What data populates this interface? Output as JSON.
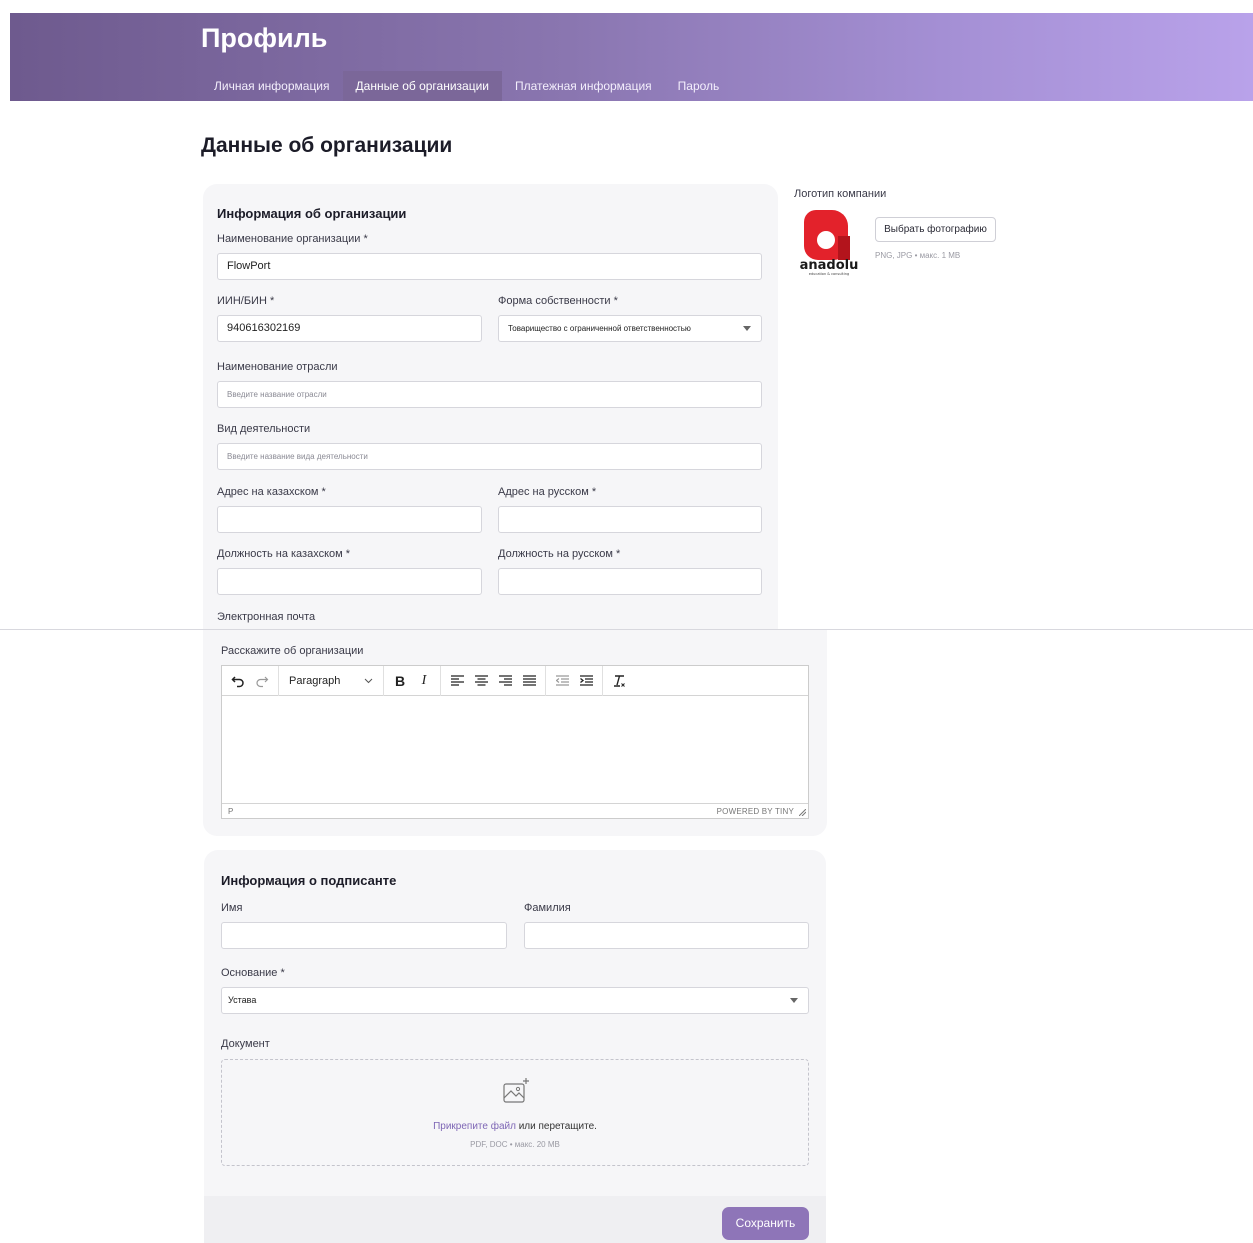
{
  "header": {
    "title": "Профиль",
    "tabs": [
      {
        "label": "Личная информация",
        "active": false
      },
      {
        "label": "Данные об организации",
        "active": true
      },
      {
        "label": "Платежная информация",
        "active": false
      },
      {
        "label": "Пароль",
        "active": false
      }
    ]
  },
  "page_title": "Данные об организации",
  "org_section": {
    "title": "Информация об организации",
    "org_name": {
      "label": "Наименование организации *",
      "value": "FlowPort"
    },
    "iin": {
      "label": "ИИН/БИН *",
      "value": "940616302169"
    },
    "ownership": {
      "label": "Форма собственности *",
      "value": "Товарищество с ограниченной ответственностью"
    },
    "industry": {
      "label": "Наименование отрасли",
      "placeholder": "Введите название отрасли"
    },
    "activity": {
      "label": "Вид деятельности",
      "placeholder": "Введите название вида деятельности"
    },
    "address_kz": {
      "label": "Адрес на казахском *",
      "value": ""
    },
    "address_ru": {
      "label": "Адрес на русском *",
      "value": ""
    },
    "position_kz": {
      "label": "Должность на казахском *",
      "value": ""
    },
    "position_ru": {
      "label": "Должность на русском *",
      "value": ""
    },
    "email": {
      "label": "Электронная почта"
    },
    "about": {
      "label": "Расскажите об организации",
      "format_select": "Paragraph",
      "status_path": "P",
      "powered_by": "POWERED BY TINY"
    }
  },
  "logo": {
    "label": "Логотип компании",
    "button": "Выбрать фотографию",
    "hint": "PNG, JPG • макс. 1 MB",
    "brand_text": "anadolu",
    "brand_sub": "education & consulting",
    "brand_color": "#e3222b"
  },
  "signer_section": {
    "title": "Информация о подписанте",
    "first_name": {
      "label": "Имя",
      "value": ""
    },
    "last_name": {
      "label": "Фамилия",
      "value": ""
    },
    "basis": {
      "label": "Основание *",
      "value": "Устава"
    },
    "document": {
      "label": "Документ",
      "link": "Прикрепите файл",
      "text": " или перетащите.",
      "hint": "PDF, DOC • макс. 20 MB"
    }
  },
  "save_button": "Сохранить",
  "colors": {
    "accent": "#8e75b8",
    "header_start": "#6e5a8e",
    "header_end": "#b9a2ea"
  }
}
